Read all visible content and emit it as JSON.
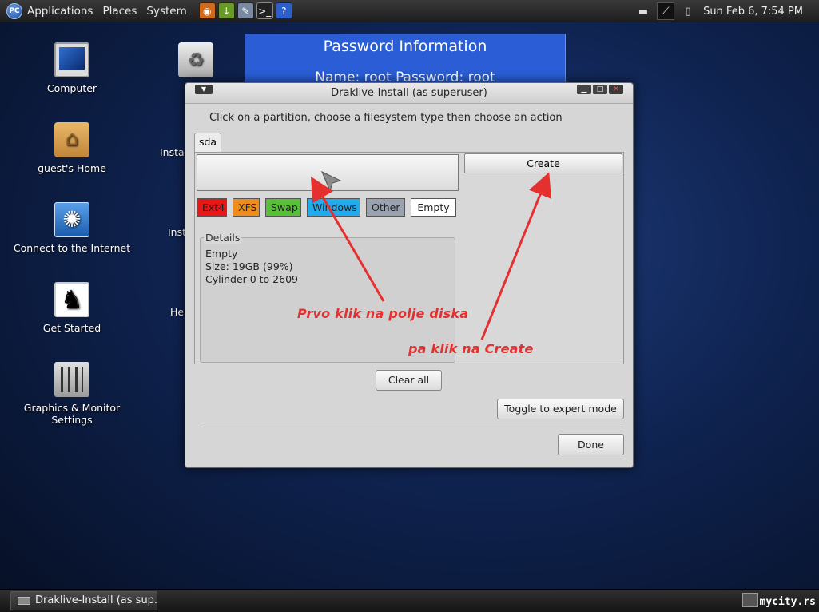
{
  "top_panel": {
    "menus": [
      "Applications",
      "Places",
      "System"
    ],
    "logo_text": "PC",
    "launchers": [
      {
        "icon": "eye-icon",
        "color": "#d06a1c"
      },
      {
        "icon": "download-icon",
        "color": "#6b9a2c"
      },
      {
        "icon": "tools-icon",
        "color": "#7a8aa0"
      },
      {
        "icon": "terminal-icon",
        "color": "#222222"
      },
      {
        "icon": "help-icon",
        "color": "#2d5fc8"
      }
    ],
    "clock": "Sun Feb  6,  7:54 PM"
  },
  "desktop": {
    "icons": [
      {
        "label": "Computer",
        "icon": "computer-icon"
      },
      {
        "label": "guest's Home",
        "icon": "home-folder-icon"
      },
      {
        "label": "Connect to the Internet",
        "icon": "network-icon"
      },
      {
        "label": "Get Started",
        "icon": "gnome-foot-icon"
      },
      {
        "label": "Graphics & Monitor Settings",
        "icon": "mixer-icon"
      }
    ],
    "partial_labels": [
      "Instal",
      "Inst",
      "Hel"
    ]
  },
  "password_panel": {
    "title": "Password Information",
    "credentials": "Name: root     Password: root"
  },
  "dialog": {
    "title": "Draklive-Install (as superuser)",
    "instruction": "Click on a partition, choose a filesystem type then choose an action",
    "tab": "sda",
    "fs_buttons": [
      {
        "label": "Ext4",
        "color": "#e81818"
      },
      {
        "label": "XFS",
        "color": "#f08c1c"
      },
      {
        "label": "Swap",
        "color": "#58c038"
      },
      {
        "label": "Windows",
        "color": "#22aaee"
      },
      {
        "label": "Other",
        "color": "#9aa2b0"
      },
      {
        "label": "Empty",
        "color": "#ffffff"
      }
    ],
    "details": {
      "legend": "Details",
      "lines": [
        "Empty",
        "Size: 19GB (99%)",
        "Cylinder 0 to 2609"
      ]
    },
    "create_label": "Create",
    "clear_all_label": "Clear all",
    "expert_label": "Toggle to expert mode",
    "done_label": "Done"
  },
  "annotations": {
    "first": "Prvo klik na polje diska",
    "second": "pa klik na Create",
    "color": "#e33030"
  },
  "bottom_panel": {
    "task_label": "Draklive-Install (as sup...",
    "watermark": "mycity.rs"
  }
}
